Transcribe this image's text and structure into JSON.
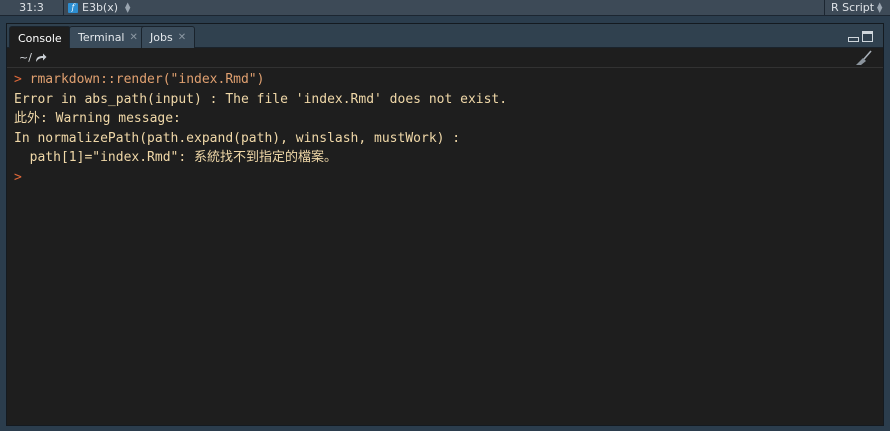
{
  "statusbar": {
    "position": "31:3",
    "function_name": "E3b(x)",
    "file_type": "R Script"
  },
  "tabs": [
    {
      "label": "Console",
      "active": true,
      "closable": false
    },
    {
      "label": "Terminal",
      "active": false,
      "closable": true
    },
    {
      "label": "Jobs",
      "active": false,
      "closable": true
    }
  ],
  "toolbar": {
    "working_dir": "~/"
  },
  "console": {
    "prompt": ">",
    "lines": [
      {
        "kind": "command",
        "text": "rmarkdown::render(\"index.Rmd\")"
      },
      {
        "kind": "output",
        "text": "Error in abs_path(input) : The file 'index.Rmd' does not exist."
      },
      {
        "kind": "output",
        "text": "此外: Warning message:"
      },
      {
        "kind": "output",
        "text": "In normalizePath(path.expand(path), winslash, mustWork) :"
      },
      {
        "kind": "output",
        "text": "  path[1]=\"index.Rmd\": 系統找不到指定的檔案。"
      },
      {
        "kind": "prompt",
        "text": ""
      }
    ]
  },
  "colors": {
    "prompt": "#e0693a",
    "command": "#e0a070",
    "output": "#f0d8a8",
    "console_bg": "#1e1e1e",
    "chrome_bg": "#2b3d4d"
  }
}
